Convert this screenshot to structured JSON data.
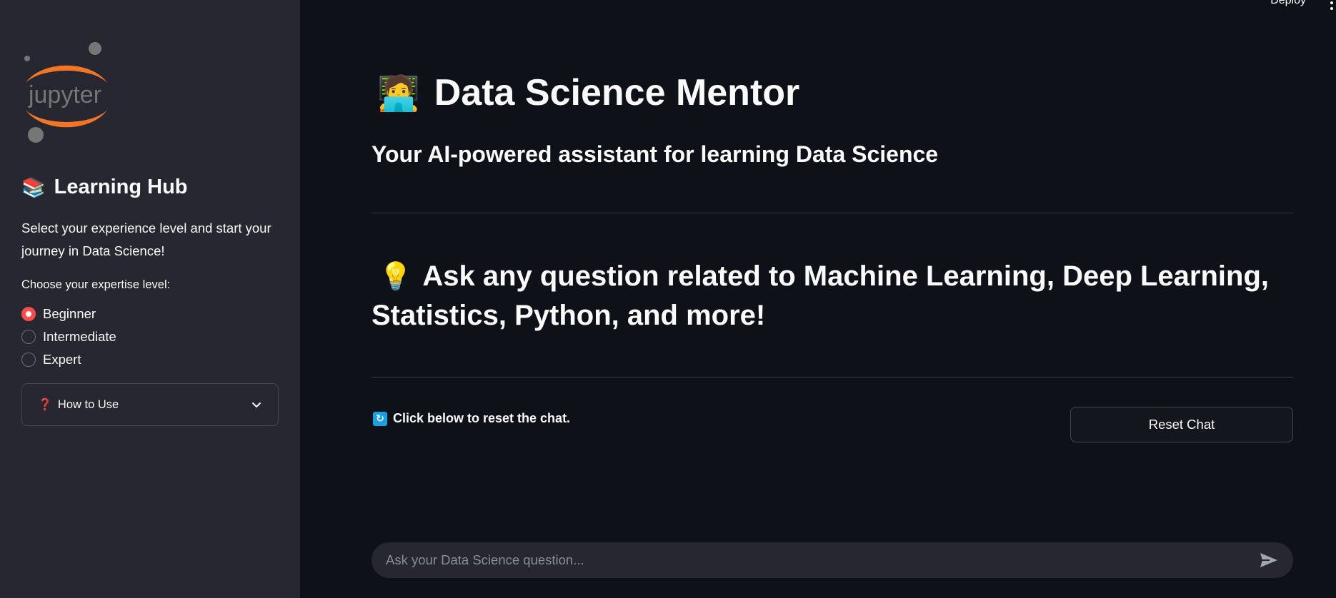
{
  "header": {
    "deploy_label": "Deploy"
  },
  "sidebar": {
    "logo_text": "jupyter",
    "hub_emoji": "📚",
    "hub_title": "Learning Hub",
    "description": "Select your experience level and start your journey in Data Science!",
    "level_label": "Choose your expertise level:",
    "levels": [
      {
        "label": "Beginner",
        "selected": true
      },
      {
        "label": "Intermediate",
        "selected": false
      },
      {
        "label": "Expert",
        "selected": false
      }
    ],
    "expander": {
      "icon": "❓",
      "label": "How to Use"
    }
  },
  "main": {
    "title_emoji": "🧑‍💻",
    "title": "Data Science Mentor",
    "subtitle": "Your AI-powered assistant for learning Data Science",
    "ask_emoji": "💡",
    "ask_heading": "Ask any question related to Machine Learning, Deep Learning, Statistics, Python, and more!",
    "reset_note": "Click below to reset the chat.",
    "reset_button": "Reset Chat",
    "chat_placeholder": "Ask your Data Science question..."
  },
  "colors": {
    "background": "#0e1117",
    "sidebar": "#262730",
    "accent": "#ff4b4b",
    "jupyter_orange": "#f37626"
  }
}
